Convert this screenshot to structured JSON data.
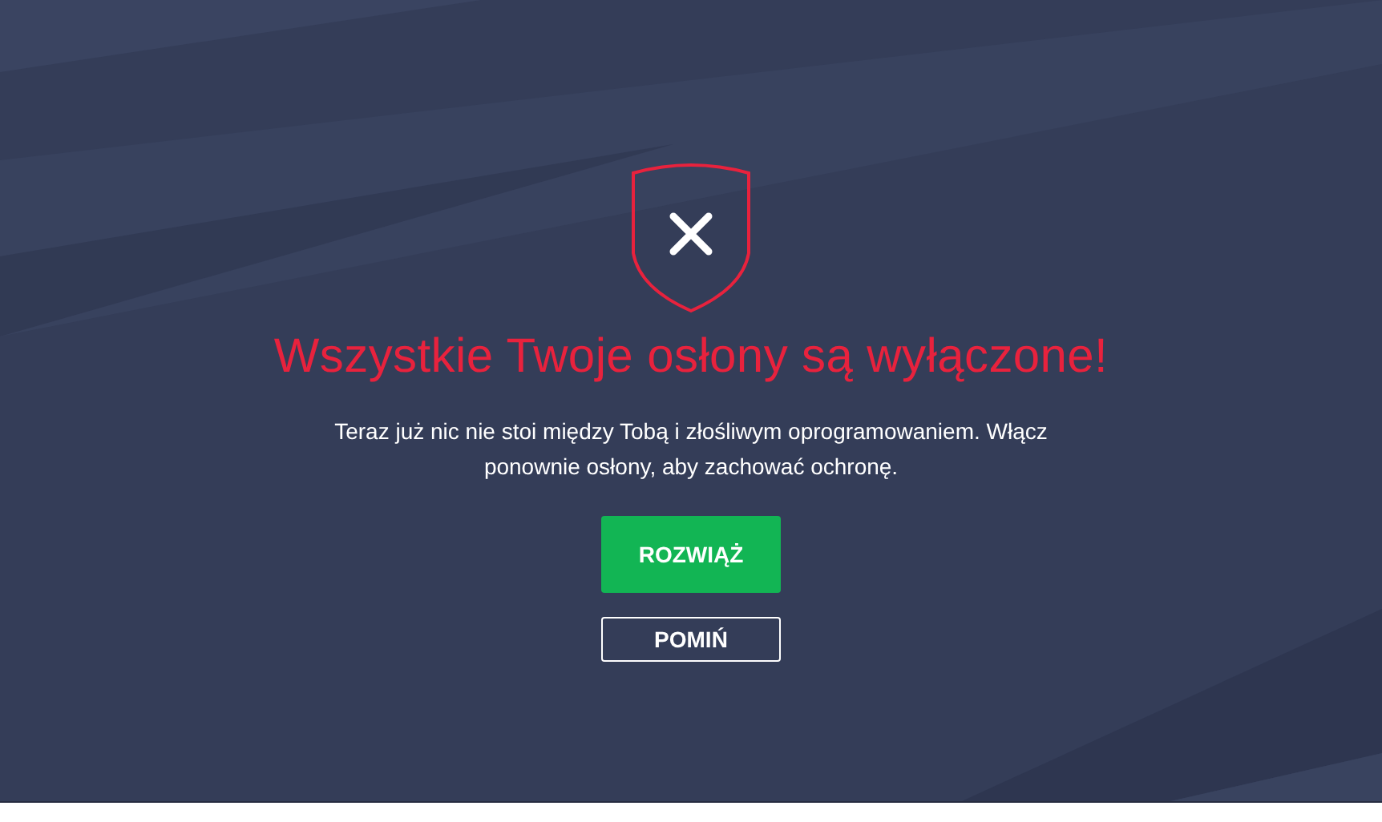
{
  "title": "Wszystkie Twoje osłony są wyłączone!",
  "message": "Teraz już nic nie stoi między Tobą i złośliwym oprogramowaniem. Włącz ponownie osłony, aby zachować ochronę.",
  "buttons": [
    {
      "label": "ROZWIĄŻ",
      "kind": "primary"
    },
    {
      "label": "POMIŃ",
      "kind": "secondary"
    }
  ]
}
